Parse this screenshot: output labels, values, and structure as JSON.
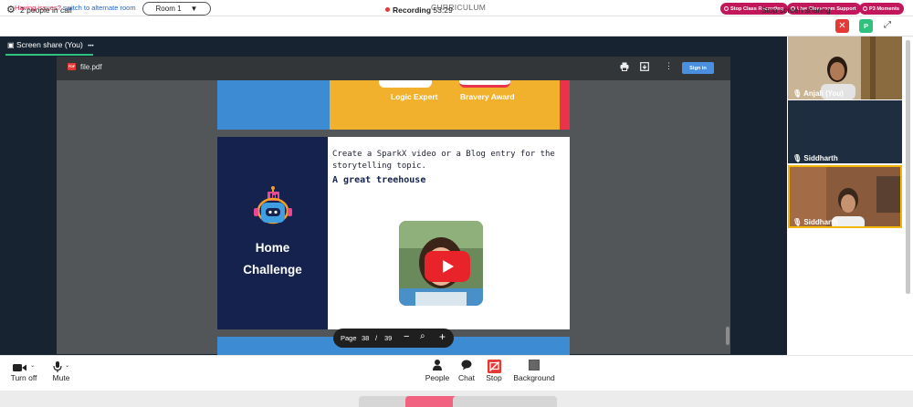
{
  "topbar": {
    "issue_prefix": "Having issues?",
    "issue_link": "switch to alternate room",
    "room_label": "Room 1",
    "room_arrow": "▼",
    "curriculum": "CURRICULUM",
    "buttons": [
      "Stop Class Recording",
      "Live Classroom Support",
      "P3 Moments"
    ]
  },
  "call": {
    "people_count": "2 people in call",
    "recording_label": "Recording",
    "recording_time": "53:29",
    "stop_sharing": "Stop screen sharing",
    "avatar_initial": "P"
  },
  "share": {
    "tab_label": "Screen share (You)",
    "tab_menu": "•••",
    "pdf": {
      "filename": "file.pdf",
      "file_badge": "PDF",
      "sign_in": "Sign in",
      "page_label": "Page",
      "page_current": "38",
      "page_sep": "/",
      "page_total": "39"
    },
    "slide_prev": {
      "badge1": "Logic Expert",
      "badge2": "Bravery Award"
    },
    "slide": {
      "heading_line1": "Home",
      "heading_line2": "Challenge",
      "prompt": "Create a SparkX video or a Blog entry for the storytelling topic.",
      "topic": "A great treehouse"
    }
  },
  "participants": [
    {
      "name": "Anjali (You)"
    },
    {
      "name": "Siddharth"
    },
    {
      "name": "Siddharth"
    }
  ],
  "controls": {
    "camera": "Turn off",
    "mic": "Mute",
    "people": "People",
    "chat": "Chat",
    "stop": "Stop",
    "background": "Background"
  },
  "colors": {
    "accent_red": "#e53935",
    "pill_magenta": "#c2185b",
    "slide_navy": "#15224d",
    "slide_yellow": "#f2b12d",
    "slide_blue": "#3d8bd3",
    "share_active": "#2ec27e",
    "highlight_gold": "#f2b705"
  },
  "icons": [
    "gear-icon",
    "close-icon",
    "expand-icon",
    "print-icon",
    "download-icon",
    "more-vert-icon",
    "camera-icon",
    "mic-icon",
    "people-icon",
    "chat-icon",
    "stop-share-icon",
    "background-icon",
    "play-icon",
    "robot-icon",
    "zoom-in-icon",
    "zoom-out-icon",
    "mic-small-icon"
  ]
}
